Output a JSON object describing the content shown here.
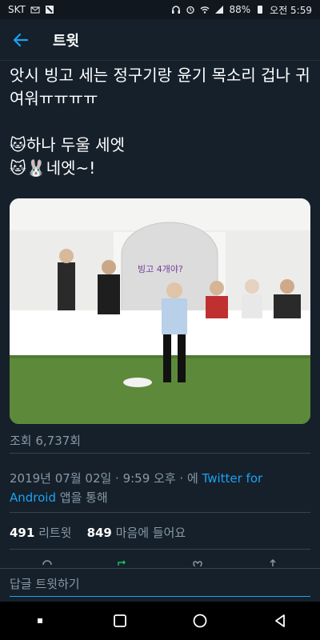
{
  "status_bar": {
    "carrier": "SKT",
    "battery": "88%",
    "time": "오전 5:59"
  },
  "app_bar": {
    "title": "트윗"
  },
  "tweet": {
    "text": "앗시 빙고 세는 정구기랑 윤기 목소리 겁나 귀여워ㅠㅠㅠㅠ\n\n🐱하나 두울 세엣\n🐱🐰네엣~!",
    "media_caption": "빙고 4개야?",
    "views": "조회 6,737회",
    "date_time": "2019년 07월 02일 · 9:59 오후 · 에 ",
    "source": "Twitter for Android",
    "source_suffix": " 앱을 통해",
    "retweets": "491",
    "retweets_label": " 리트윗",
    "likes": "849",
    "likes_label": " 마음에 들어요"
  },
  "reply": {
    "placeholder": "답글 트윗하기"
  },
  "colors": {
    "background": "#15202b",
    "accent": "#1da1f2",
    "secondary_text": "#8899a6",
    "divider": "#38444d"
  },
  "icons": {
    "back": "arrow-left-icon",
    "reply": "reply-icon",
    "retweet": "retweet-icon",
    "like": "heart-icon",
    "share": "share-icon"
  }
}
